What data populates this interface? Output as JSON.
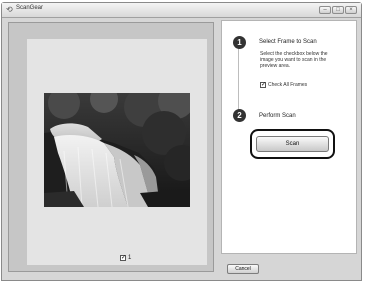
{
  "window": {
    "title": "ScanGear",
    "app_icon": "scangear-icon",
    "controls": [
      "minimize-icon",
      "maximize-icon",
      "close-icon"
    ]
  },
  "preview": {
    "frame_number": "1",
    "frame_checked": true,
    "image_subject": "waterfall"
  },
  "steps": [
    {
      "number": "1",
      "title": "Select Frame to Scan",
      "description": "Select the checkbox below the image you want to scan in the preview area.",
      "checkbox_label": "Check All Frames",
      "checkbox_checked": true
    },
    {
      "number": "2",
      "title": "Perform Scan",
      "button_label": "Scan"
    }
  ],
  "footer": {
    "cancel_label": "Cancel"
  },
  "colors": {
    "window_bg": "#d6d6d6",
    "panel_bg": "#ffffff",
    "step_circle": "#333333"
  }
}
